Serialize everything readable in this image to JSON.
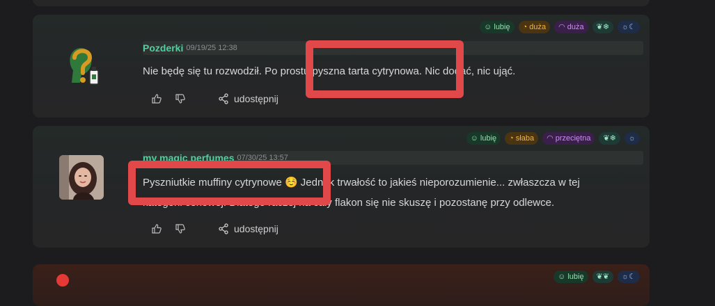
{
  "reviews": [
    {
      "author": "Pozderki",
      "date": "09/19/25 12:38",
      "text": "Nie będę się tu rozwodził. Po prostu pyszna tarta cytrynowa. Nic dodać, nic ująć.",
      "badges": [
        {
          "label": "lubię",
          "icon": "smile-icon"
        },
        {
          "label": "duża",
          "icon": "clock-icon"
        },
        {
          "label": "duża",
          "icon": "sillage-icon"
        },
        {
          "label": "",
          "icon": "leaf-snow-icon"
        },
        {
          "label": "",
          "icon": "sun-moon-icon"
        }
      ],
      "share_label": "udostępnij"
    },
    {
      "author": "my magic perfumes",
      "date": "07/30/25 13:57",
      "text_line1": "Pyszniutkie muffiny cytrynowe ☺️ Jednak trwałość to jakieś nieporozumienie... zwłaszcza w tej",
      "text_line2": "kategorii cenowej. Dlatego raczej na cały flakon się nie skuszę i pozostanę przy odlewce.",
      "badges": [
        {
          "label": "lubię",
          "icon": "smile-icon"
        },
        {
          "label": "słaba",
          "icon": "clock-icon"
        },
        {
          "label": "przeciętna",
          "icon": "sillage-icon"
        },
        {
          "label": "",
          "icon": "leaf-snow-icon"
        },
        {
          "label": "",
          "icon": "sun-icon"
        }
      ],
      "share_label": "udostępnij"
    },
    {
      "badges": [
        {
          "label": "lubię",
          "icon": "smile-icon"
        },
        {
          "label": "",
          "icon": "leaf-icon"
        },
        {
          "label": "",
          "icon": "sun-moon-icon"
        }
      ]
    }
  ],
  "colors": {
    "accent": "#4dd1a0",
    "highlight": "#e0484a",
    "background": "#1c1c1e"
  }
}
